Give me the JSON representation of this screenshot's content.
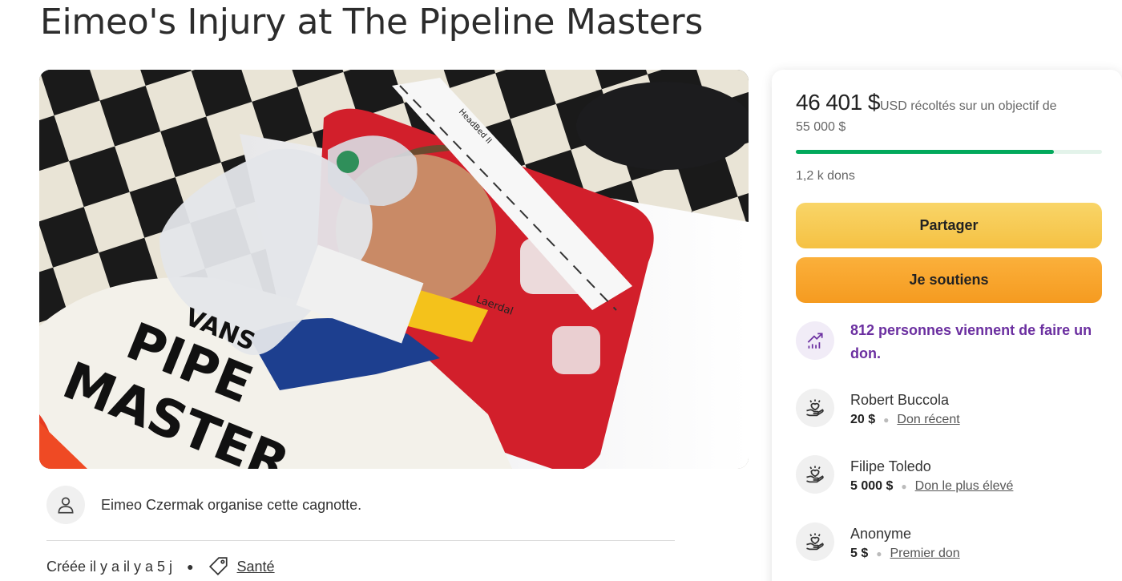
{
  "page": {
    "title": "Eimeo's Injury at The Pipeline Masters"
  },
  "hero": {
    "shirt_lines": [
      "VANS",
      "PIPE",
      "MASTER"
    ],
    "device_label": "Laerdal",
    "strap_label": "HeadBed II"
  },
  "organizer": {
    "text": "Eimeo Czermak organise cette cagnotte.",
    "icon": "user-icon"
  },
  "meta": {
    "created": "Créée il y a il y a 5 j",
    "category": "Santé",
    "category_icon": "tag-icon"
  },
  "fundraiser": {
    "raised": "46 401 $",
    "raised_suffix": "USD récoltés sur un objectif de",
    "goal": "55 000 $",
    "progress": 0.844,
    "donations_count": "1,2 k dons",
    "share_label": "Partager",
    "support_label": "Je soutiens",
    "trend_text": "812 personnes viennent de faire un don.",
    "colors": {
      "progress": "#02a95c",
      "share": "#f7cb56",
      "support": "#f8a52d",
      "trend_text": "#6b2fa0"
    }
  },
  "donors": [
    {
      "name": "Robert Buccola",
      "amount": "20 $",
      "label": "Don récent"
    },
    {
      "name": "Filipe Toledo",
      "amount": "5 000 $",
      "label": "Don le plus élevé"
    },
    {
      "name": "Anonyme",
      "amount": "5 $",
      "label": "Premier don"
    }
  ]
}
